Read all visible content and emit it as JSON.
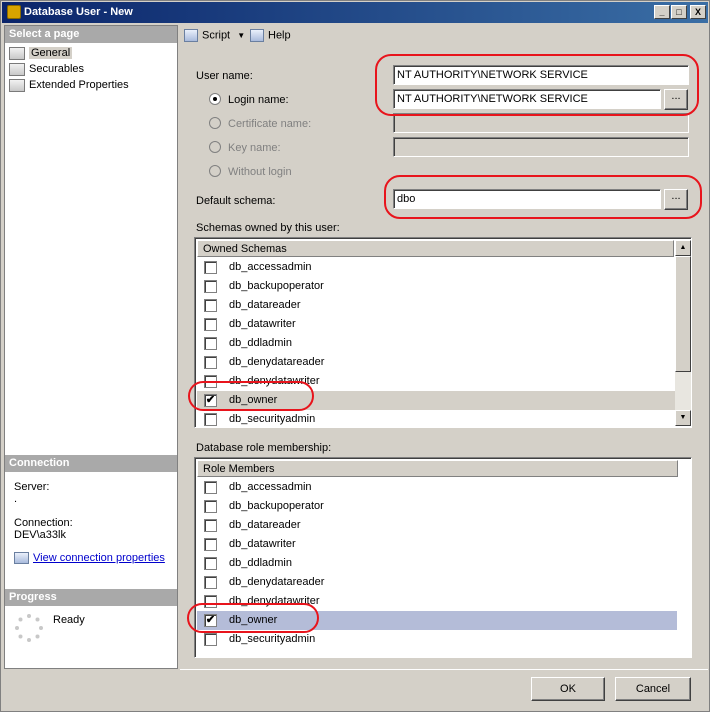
{
  "window": {
    "title": "Database User - New",
    "controls": [
      "_",
      "□",
      "X"
    ]
  },
  "sidebar": {
    "select_page_header": "Select a page",
    "pages": [
      {
        "label": "General",
        "icon": "page-icon",
        "selected": true
      },
      {
        "label": "Securables",
        "icon": "page-icon",
        "selected": false
      },
      {
        "label": "Extended Properties",
        "icon": "page-icon",
        "selected": false
      }
    ],
    "connection_header": "Connection",
    "server_label": "Server:",
    "server_value": ".",
    "connection_label": "Connection:",
    "connection_value": "DEV\\a33lk",
    "view_connection_link": "View connection properties",
    "progress_header": "Progress",
    "progress_status": "Ready"
  },
  "toolbar": {
    "script_label": "Script",
    "help_label": "Help"
  },
  "form": {
    "user_name_label": "User name:",
    "user_name_value": "NT AUTHORITY\\NETWORK SERVICE",
    "login_name_label": "Login name:",
    "login_name_value": "NT AUTHORITY\\NETWORK SERVICE",
    "certificate_name_label": "Certificate name:",
    "key_name_label": "Key name:",
    "without_login_label": "Without login",
    "default_schema_label": "Default schema:",
    "default_schema_value": "dbo",
    "browse_label": "..."
  },
  "schemas": {
    "section_label": "Schemas owned by this user:",
    "column_header": "Owned Schemas",
    "items": [
      {
        "name": "db_accessadmin",
        "checked": false
      },
      {
        "name": "db_backupoperator",
        "checked": false
      },
      {
        "name": "db_datareader",
        "checked": false
      },
      {
        "name": "db_datawriter",
        "checked": false
      },
      {
        "name": "db_ddladmin",
        "checked": false
      },
      {
        "name": "db_denydatareader",
        "checked": false
      },
      {
        "name": "db_denydatawriter",
        "checked": false
      },
      {
        "name": "db_owner",
        "checked": true
      },
      {
        "name": "db_securityadmin",
        "checked": false
      }
    ]
  },
  "roles": {
    "section_label": "Database role membership:",
    "column_header": "Role Members",
    "items": [
      {
        "name": "db_accessadmin",
        "checked": false
      },
      {
        "name": "db_backupoperator",
        "checked": false
      },
      {
        "name": "db_datareader",
        "checked": false
      },
      {
        "name": "db_datawriter",
        "checked": false
      },
      {
        "name": "db_ddladmin",
        "checked": false
      },
      {
        "name": "db_denydatareader",
        "checked": false
      },
      {
        "name": "db_denydatawriter",
        "checked": false
      },
      {
        "name": "db_owner",
        "checked": true
      },
      {
        "name": "db_securityadmin",
        "checked": false
      }
    ]
  },
  "footer": {
    "ok_label": "OK",
    "cancel_label": "Cancel"
  },
  "colors": {
    "annotation": "#e8141c",
    "schema_selected_row": "#d4d0c8",
    "role_selected_row": "#b4bcd8"
  }
}
